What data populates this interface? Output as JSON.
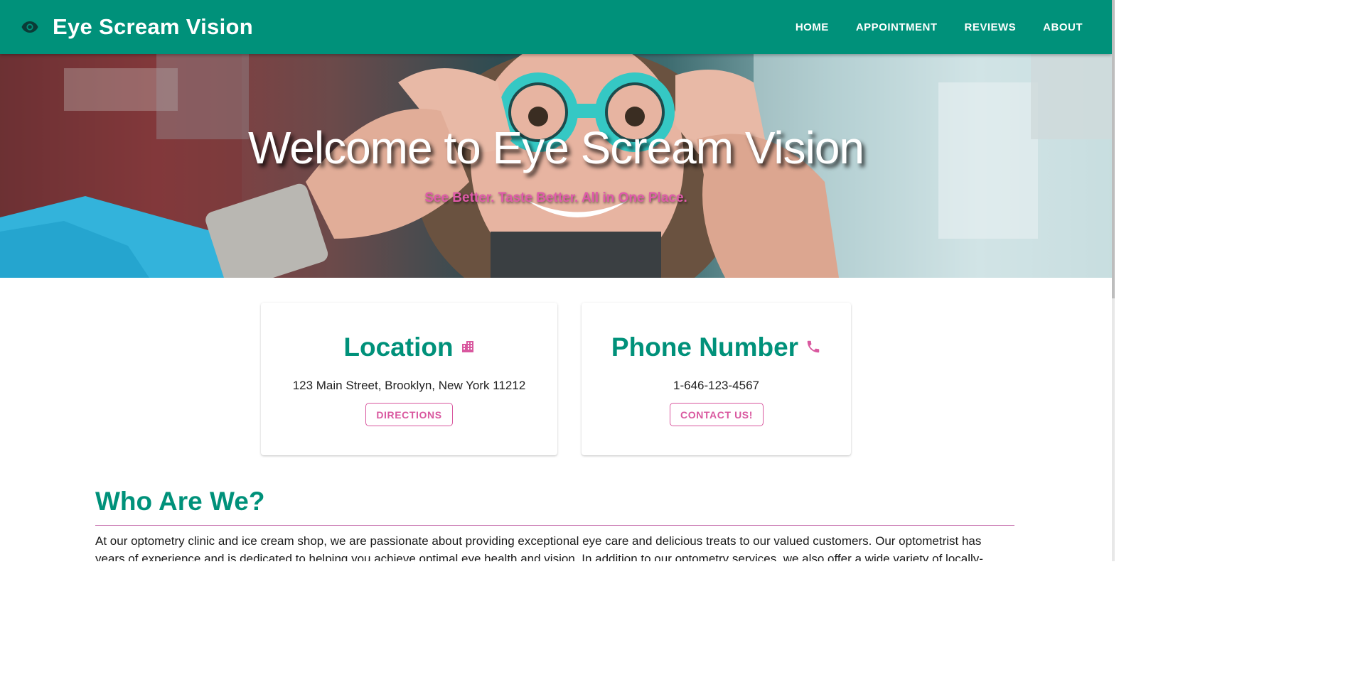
{
  "header": {
    "brand_title": "Eye Scream Vision",
    "brand_icon": "eye-icon",
    "nav": [
      "HOME",
      "APPOINTMENT",
      "REVIEWS",
      "ABOUT"
    ]
  },
  "hero": {
    "title": "Welcome to Eye Scream Vision",
    "subtitle": "See Better. Taste Better. All in One Place."
  },
  "cards": {
    "location": {
      "title": "Location",
      "icon": "building-icon",
      "text": "123 Main Street, Brooklyn, New York 11212",
      "button": "DIRECTIONS"
    },
    "phone": {
      "title": "Phone Number",
      "icon": "phone-icon",
      "text": "1-646-123-4567",
      "button": "CONTACT US!"
    }
  },
  "about": {
    "title": "Who Are We?",
    "body": "At our optometry clinic and ice cream shop, we are passionate about providing exceptional eye care and delicious treats to our valued customers. Our optometrist has years of experience and is dedicated to helping you achieve optimal eye health and vision. In addition to our optometry services, we also offer a wide variety of locally-"
  },
  "colors": {
    "primary": "#00917a",
    "accent": "#d9589f",
    "text": "#222222",
    "background": "#ffffff"
  }
}
